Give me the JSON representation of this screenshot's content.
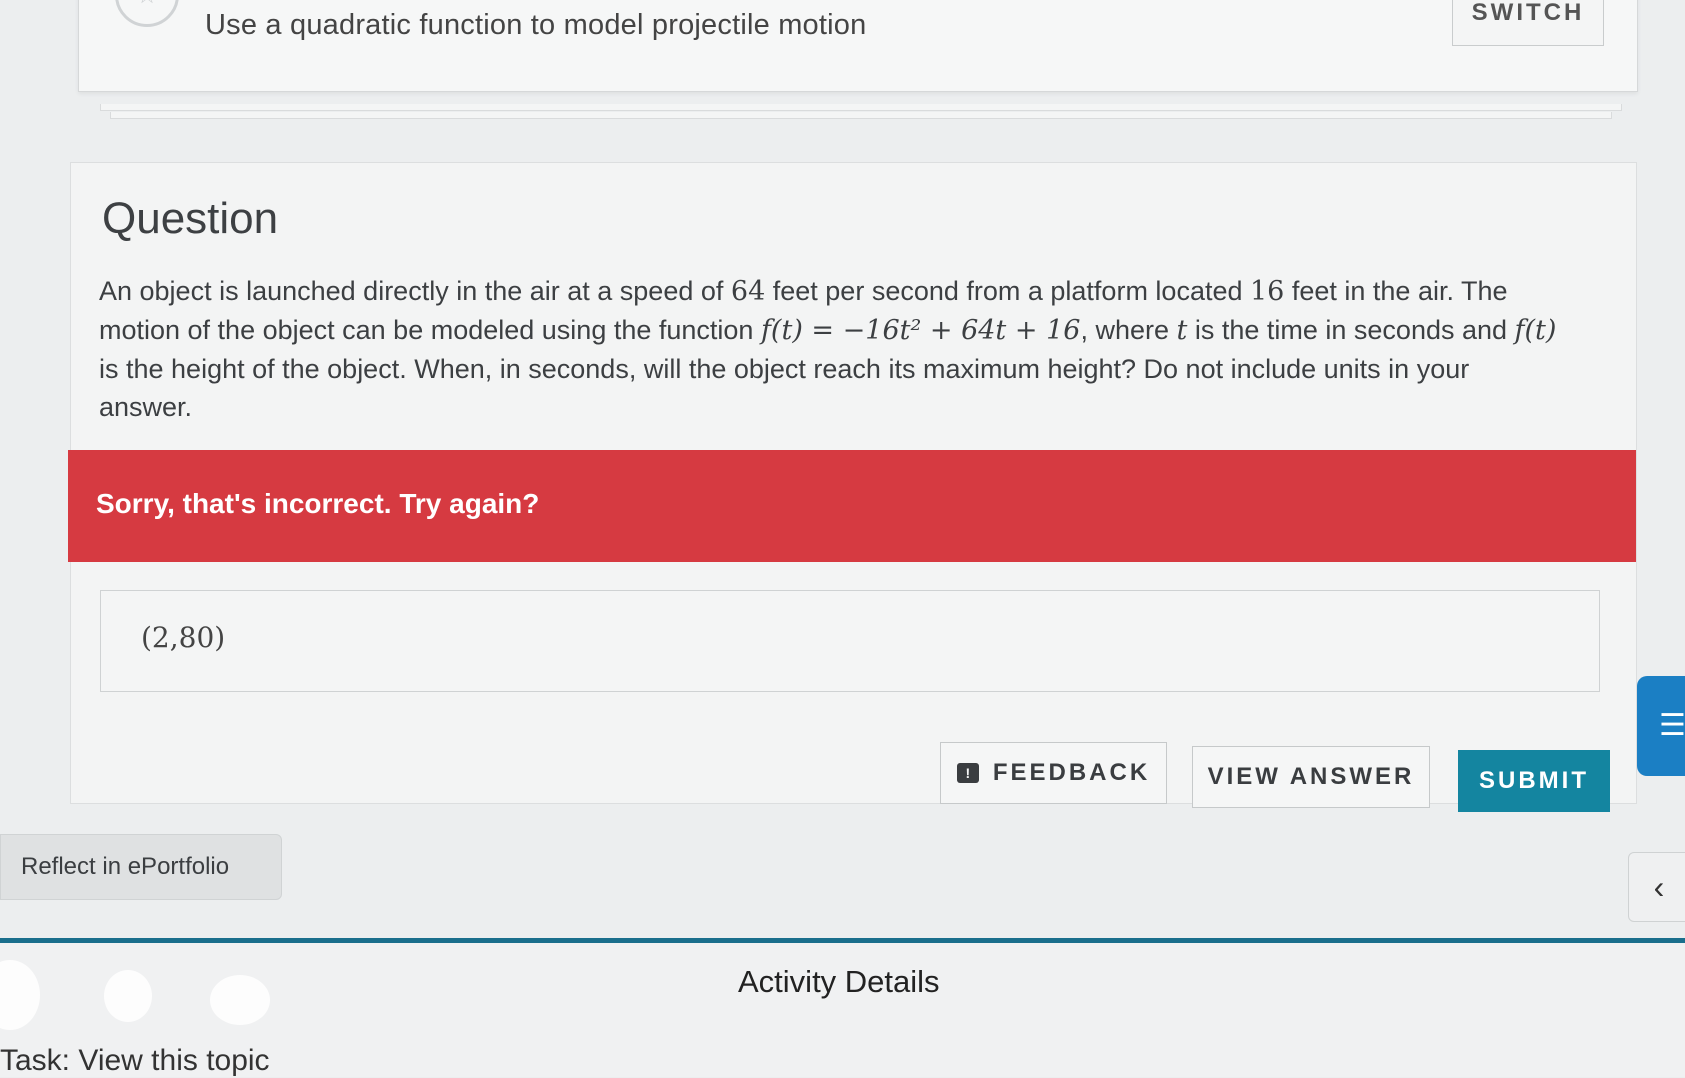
{
  "topic": {
    "title": "Use a quadratic function to model projectile motion",
    "switch_label": "SWITCH",
    "star_icon": "star-outline-icon"
  },
  "question": {
    "heading": "Question",
    "text_part1": "An object is launched directly in the air at a speed of ",
    "speed": "64",
    "text_part2": " feet per second from a platform located ",
    "height": "16",
    "text_part3": " feet in the air. The motion of the object can be modeled using the function ",
    "function": "f(t) = −16t² + 64t + 16",
    "text_part4": ", where ",
    "var_t": "t",
    "text_part5": " is the time in seconds and ",
    "f_of_t": "f(t)",
    "text_part6": " is the height of the object. When, in seconds, will the object reach its maximum height? Do not include units in your answer."
  },
  "feedback_banner": {
    "message": "Sorry, that's incorrect. Try again?",
    "color": "#d63a41"
  },
  "answer": {
    "value": "(2,80)"
  },
  "actions": {
    "feedback_label": "FEEDBACK",
    "view_answer_label": "VIEW ANSWER",
    "submit_label": "SUBMIT",
    "submit_color": "#1485a0"
  },
  "sidebar": {
    "reflect_label": "Reflect in ePortfolio",
    "collapse_icon": "chevron-left-icon",
    "chat_icon": "chat-lines-icon"
  },
  "footer": {
    "activity_title": "Activity Details",
    "task_text": "Task: View this topic"
  }
}
